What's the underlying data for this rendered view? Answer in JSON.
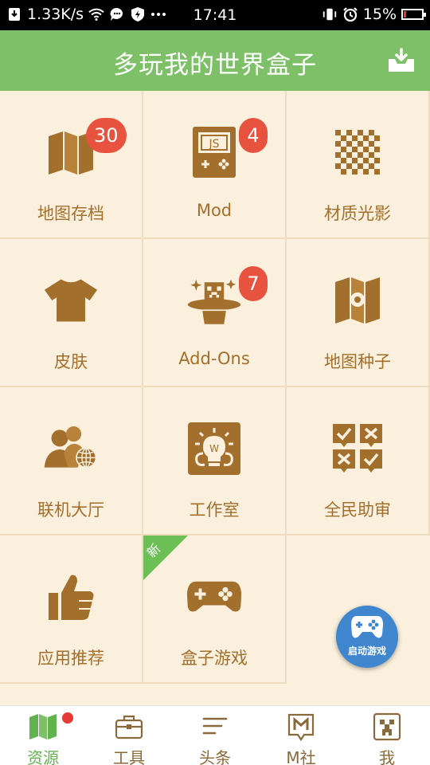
{
  "status_bar": {
    "net_speed": "1.33K/s",
    "time": "17:41",
    "battery": "15%",
    "battery_level": 0.15,
    "icons": [
      "download-notification-icon",
      "wifi-icon",
      "chat-icon",
      "shield-icon",
      "more-dots-icon",
      "vibrate-icon",
      "alarm-icon",
      "battery-icon"
    ]
  },
  "header": {
    "title": "多玩我的世界盒子",
    "download_icon": "download-tray-icon"
  },
  "grid": [
    {
      "label": "地图存档",
      "icon": "map-icon",
      "badge": "30"
    },
    {
      "label": "Mod",
      "icon": "js-gameboy-icon",
      "badge": "4"
    },
    {
      "label": "材质光影",
      "icon": "checker-texture-icon",
      "badge": ""
    },
    {
      "label": "皮肤",
      "icon": "shirt-icon",
      "badge": ""
    },
    {
      "label": "Add-Ons",
      "icon": "magic-hat-icon",
      "badge": "7"
    },
    {
      "label": "地图种子",
      "icon": "map-seed-icon",
      "badge": ""
    },
    {
      "label": "联机大厅",
      "icon": "multiplayer-globe-icon",
      "badge": ""
    },
    {
      "label": "工作室",
      "icon": "studio-bulb-icon",
      "badge": ""
    },
    {
      "label": "全民助审",
      "icon": "review-checks-icon",
      "badge": ""
    },
    {
      "label": "应用推荐",
      "icon": "thumbs-up-icon",
      "badge": ""
    },
    {
      "label": "盒子游戏",
      "icon": "gamepad-icon",
      "badge": "",
      "ribbon": "新"
    }
  ],
  "fab": {
    "label": "启动游戏",
    "icon": "gamepad-icon"
  },
  "bottom_nav": [
    {
      "label": "资源",
      "icon": "map-icon",
      "active": true
    },
    {
      "label": "工具",
      "icon": "toolbox-icon",
      "active": false
    },
    {
      "label": "头条",
      "icon": "headlines-icon",
      "active": false
    },
    {
      "label": "M社",
      "icon": "m-community-icon",
      "active": false
    },
    {
      "label": "我",
      "icon": "creeper-face-icon",
      "active": false
    }
  ],
  "colors": {
    "header_bg": "#7dc067",
    "icon_brown": "#a36f2c",
    "badge_red": "#e7533f",
    "page_bg": "#fbf0de",
    "nav_active": "#62b24e"
  }
}
